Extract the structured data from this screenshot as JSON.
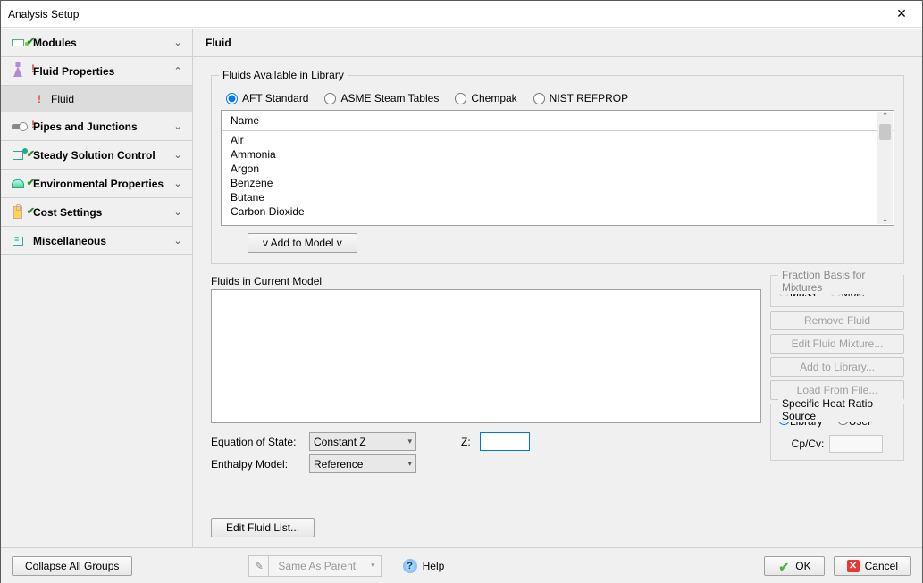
{
  "window": {
    "title": "Analysis Setup"
  },
  "sidebar": {
    "items": [
      {
        "label": "Modules",
        "status": "ok"
      },
      {
        "label": "Fluid Properties",
        "status": "warn",
        "expanded": true
      },
      {
        "label": "Pipes and Junctions",
        "status": "warn"
      },
      {
        "label": "Steady Solution Control",
        "status": "ok"
      },
      {
        "label": "Environmental Properties",
        "status": "ok"
      },
      {
        "label": "Cost Settings",
        "status": "ok"
      },
      {
        "label": "Miscellaneous",
        "status": "none"
      }
    ],
    "sub": {
      "label": "Fluid"
    }
  },
  "content": {
    "header": "Fluid",
    "library": {
      "label": "Fluids Available in Library",
      "sources": [
        "AFT Standard",
        "ASME Steam Tables",
        "Chempak",
        "NIST REFPROP"
      ],
      "selected_source": "AFT Standard",
      "col_header": "Name",
      "fluids": [
        "Air",
        "Ammonia",
        "Argon",
        "Benzene",
        "Butane",
        "Carbon Dioxide"
      ],
      "add_button": "v  Add to Model  v"
    },
    "current_model": {
      "label": "Fluids in Current Model"
    },
    "fraction_basis": {
      "label": "Fraction Basis for Mixtures",
      "options": [
        "Mass",
        "Mole"
      ]
    },
    "buttons": {
      "remove": "Remove Fluid",
      "edit_mix": "Edit Fluid Mixture...",
      "add_lib": "Add to Library...",
      "load_file": "Load From File..."
    },
    "heat_ratio": {
      "label": "Specific Heat Ratio Source",
      "options": [
        "Library",
        "User"
      ],
      "selected": "Library",
      "cpcv": "Cp/Cv:"
    },
    "eos": {
      "label": "Equation of State:",
      "value": "Constant Z",
      "z_label": "Z:"
    },
    "enthalpy": {
      "label": "Enthalpy Model:",
      "value": "Reference"
    },
    "edit_list": "Edit Fluid List..."
  },
  "footer": {
    "collapse": "Collapse All Groups",
    "same_parent": "Same As Parent",
    "help": "Help",
    "ok": "OK",
    "cancel": "Cancel"
  }
}
